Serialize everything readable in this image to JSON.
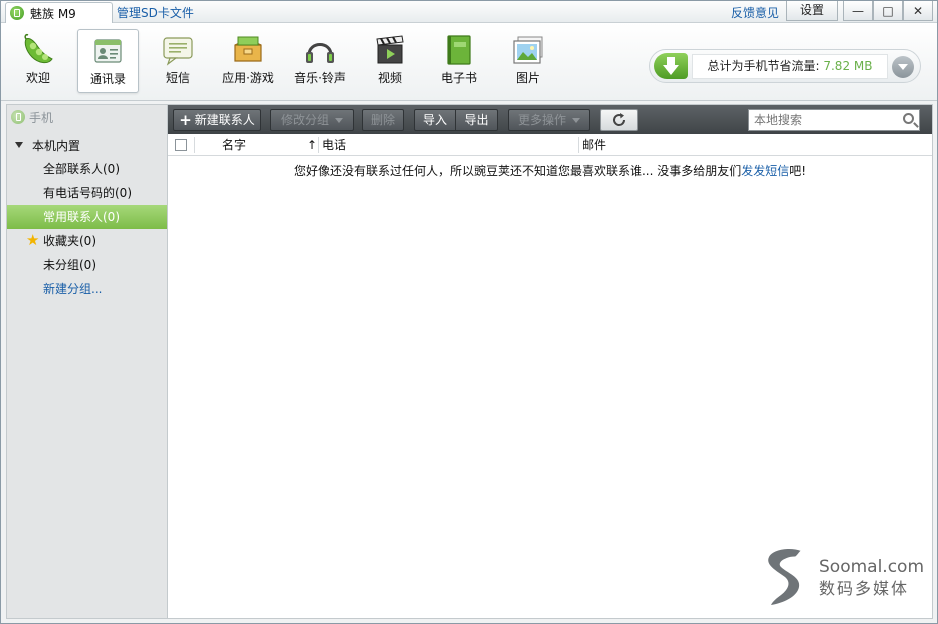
{
  "titlebar": {
    "device_name": "魅族 M9",
    "sd_link": "管理SD卡文件",
    "feedback": "反馈意见",
    "settings": "设置",
    "minimize": "—",
    "maximize": "□",
    "close": "✕"
  },
  "nav": {
    "items": [
      {
        "label": "欢迎",
        "icon": "peapod-icon"
      },
      {
        "label": "通讯录",
        "icon": "contacts-card-icon",
        "active": true
      },
      {
        "label": "短信",
        "icon": "message-bubble-icon"
      },
      {
        "label": "应用·游戏",
        "icon": "app-box-icon"
      },
      {
        "label": "音乐·铃声",
        "icon": "headphones-icon"
      },
      {
        "label": "视频",
        "icon": "clapperboard-icon"
      },
      {
        "label": "电子书",
        "icon": "ebook-icon"
      },
      {
        "label": "图片",
        "icon": "picture-icon"
      }
    ]
  },
  "traffic": {
    "label": "总计为手机节省流量: ",
    "value": "7.82 MB",
    "accent_color": "#6ab04a"
  },
  "sidebar": {
    "phone_label": "手机",
    "group_label": "本机内置",
    "items": [
      {
        "label": "全部联系人(0)"
      },
      {
        "label": "有电话号码的(0)"
      },
      {
        "label": "常用联系人(0)",
        "active": true
      },
      {
        "label": "收藏夹(0)",
        "icon": "star-icon"
      },
      {
        "label": "未分组(0)"
      },
      {
        "label": "新建分组...",
        "link": true
      }
    ]
  },
  "toolbar": {
    "new_contact": "新建联系人",
    "edit_group": "修改分组",
    "delete": "删除",
    "import": "导入",
    "export": "导出",
    "more_actions": "更多操作",
    "search_placeholder": "本地搜索"
  },
  "table": {
    "columns": [
      "名字",
      "电话",
      "邮件"
    ],
    "sort_indicator": "↑"
  },
  "empty_state": {
    "message": "您好像还没有联系过任何人，所以豌豆荚还不知道您最喜欢联系谁... 没事多给朋友们",
    "link": "发发短信",
    "suffix": "吧!"
  },
  "watermark": {
    "line1": "Soomal.com",
    "line2": "数码多媒体"
  },
  "colors": {
    "accent_green": "#7dbc48",
    "link_blue": "#1a5fa8",
    "toolbar_dark": "#4a4f53"
  }
}
